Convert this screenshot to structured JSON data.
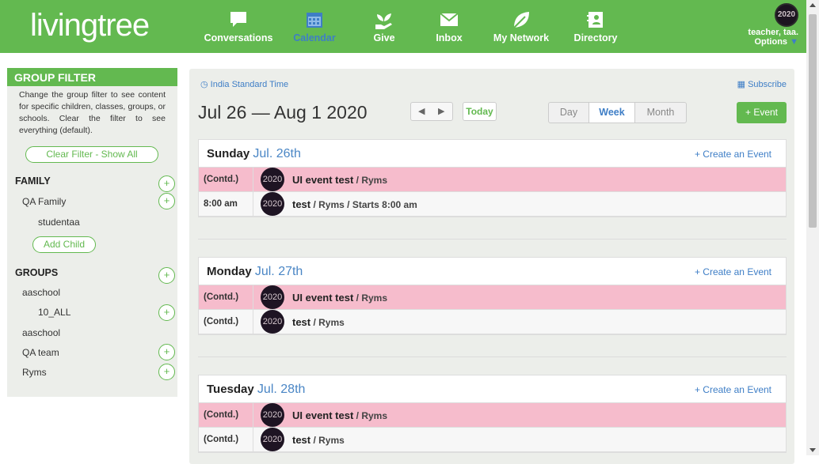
{
  "app": {
    "logo": "livingtree"
  },
  "nav": [
    {
      "label": "Conversations",
      "icon": "speech-bubble-icon"
    },
    {
      "label": "Calendar",
      "icon": "calendar-icon",
      "active": true
    },
    {
      "label": "Give",
      "icon": "hand-plant-icon"
    },
    {
      "label": "Inbox",
      "icon": "envelope-icon"
    },
    {
      "label": "My Network",
      "icon": "leaf-icon"
    },
    {
      "label": "Directory",
      "icon": "contact-card-icon"
    }
  ],
  "user": {
    "name": "teacher, taa.",
    "options": "Options",
    "avatar_text": "2020"
  },
  "sidebar": {
    "title": "GROUP FILTER",
    "description": "Change the group filter to see content for specific children, classes, groups, or schools. Clear the filter to see everything (default).",
    "clear_filter": "Clear Filter - Show All",
    "family_heading": "FAMILY",
    "family_items": [
      "QA Family",
      "studentaa"
    ],
    "add_child": "Add Child",
    "groups_heading": "GROUPS",
    "groups_items": [
      "aaschool",
      "10_ALL",
      "aaschool",
      "QA team",
      "Ryms"
    ],
    "plus": "+"
  },
  "calendar": {
    "timezone": "India Standard Time",
    "subscribe": "Subscribe",
    "range": "Jul 26 — Aug 1 2020",
    "prev": "◀",
    "next": "▶",
    "today": "Today",
    "views": [
      "Day",
      "Week",
      "Month"
    ],
    "active_view": "Week",
    "add_event": "+ Event",
    "create_event": "+ Create an Event",
    "days": [
      {
        "name": "Sunday",
        "date": "Jul. 26th",
        "events": [
          {
            "time": "(Contd.)",
            "title": "UI event test",
            "detail": " / Ryms",
            "highlight": true
          },
          {
            "time": "8:00 am",
            "title": "test",
            "detail": " / Ryms / Starts 8:00 am",
            "highlight": false
          }
        ]
      },
      {
        "name": "Monday",
        "date": "Jul. 27th",
        "events": [
          {
            "time": "(Contd.)",
            "title": "UI event test",
            "detail": " / Ryms",
            "highlight": true
          },
          {
            "time": "(Contd.)",
            "title": "test",
            "detail": " / Ryms",
            "highlight": false
          }
        ]
      },
      {
        "name": "Tuesday",
        "date": "Jul. 28th",
        "events": [
          {
            "time": "(Contd.)",
            "title": "UI event test",
            "detail": " / Ryms",
            "highlight": true
          },
          {
            "time": "(Contd.)",
            "title": "test",
            "detail": " / Ryms",
            "highlight": false
          }
        ]
      }
    ]
  },
  "colors": {
    "brand_green": "#63b950",
    "link_blue": "#3e7ec6",
    "event_pink": "#f6bccc"
  }
}
